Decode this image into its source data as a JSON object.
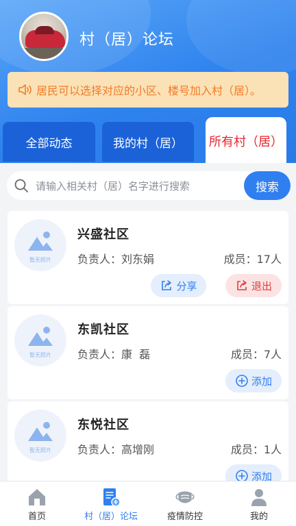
{
  "header": {
    "title": "村（居）论坛",
    "notice": "居民可以选择对应的小区、楼号加入村（居）。",
    "gradient_colors": [
      "#5aa6f8",
      "#2a7be8"
    ]
  },
  "tabs": [
    {
      "label": "全部动态",
      "active": false
    },
    {
      "label": "我的村（居）",
      "active": false
    },
    {
      "label": "所有村（居）",
      "active": true
    }
  ],
  "search": {
    "placeholder": "请输入相关村（居）名字进行搜索",
    "button_label": "搜索"
  },
  "communities": [
    {
      "thumb_label": "暂无照片",
      "name": "兴盛社区",
      "leader": "负责人：刘东娟",
      "members": "成员：17人",
      "actions": [
        {
          "label": "分享",
          "icon": "share-icon"
        },
        {
          "label": "退出",
          "icon": "exit-icon"
        }
      ]
    },
    {
      "thumb_label": "暂无照片",
      "name": "东凯社区",
      "leader": "负责人：康  磊",
      "members": "成员：7人",
      "actions": [
        {
          "label": "添加",
          "icon": "plus-circle-icon"
        }
      ]
    },
    {
      "thumb_label": "暂无照片",
      "name": "东悦社区",
      "leader": "负责人：高增刚",
      "members": "成员：1人",
      "actions": [
        {
          "label": "添加",
          "icon": "plus-circle-icon"
        }
      ]
    }
  ],
  "bottom_nav": [
    {
      "label": "首页",
      "icon": "home-icon",
      "active": false
    },
    {
      "label": "村（居）论坛",
      "icon": "forum-icon",
      "active": true
    },
    {
      "label": "疫情防控",
      "icon": "mask-icon",
      "active": false
    },
    {
      "label": "我的",
      "icon": "user-icon",
      "active": false
    }
  ],
  "colors": {
    "primary": "#2f7ff0",
    "tab_dark": "#1b62d8",
    "active_tab_text": "#e8262f",
    "notice_bg": "#fbe2b6",
    "notice_text": "#f07b2a",
    "quit_text": "#e23b3b"
  }
}
